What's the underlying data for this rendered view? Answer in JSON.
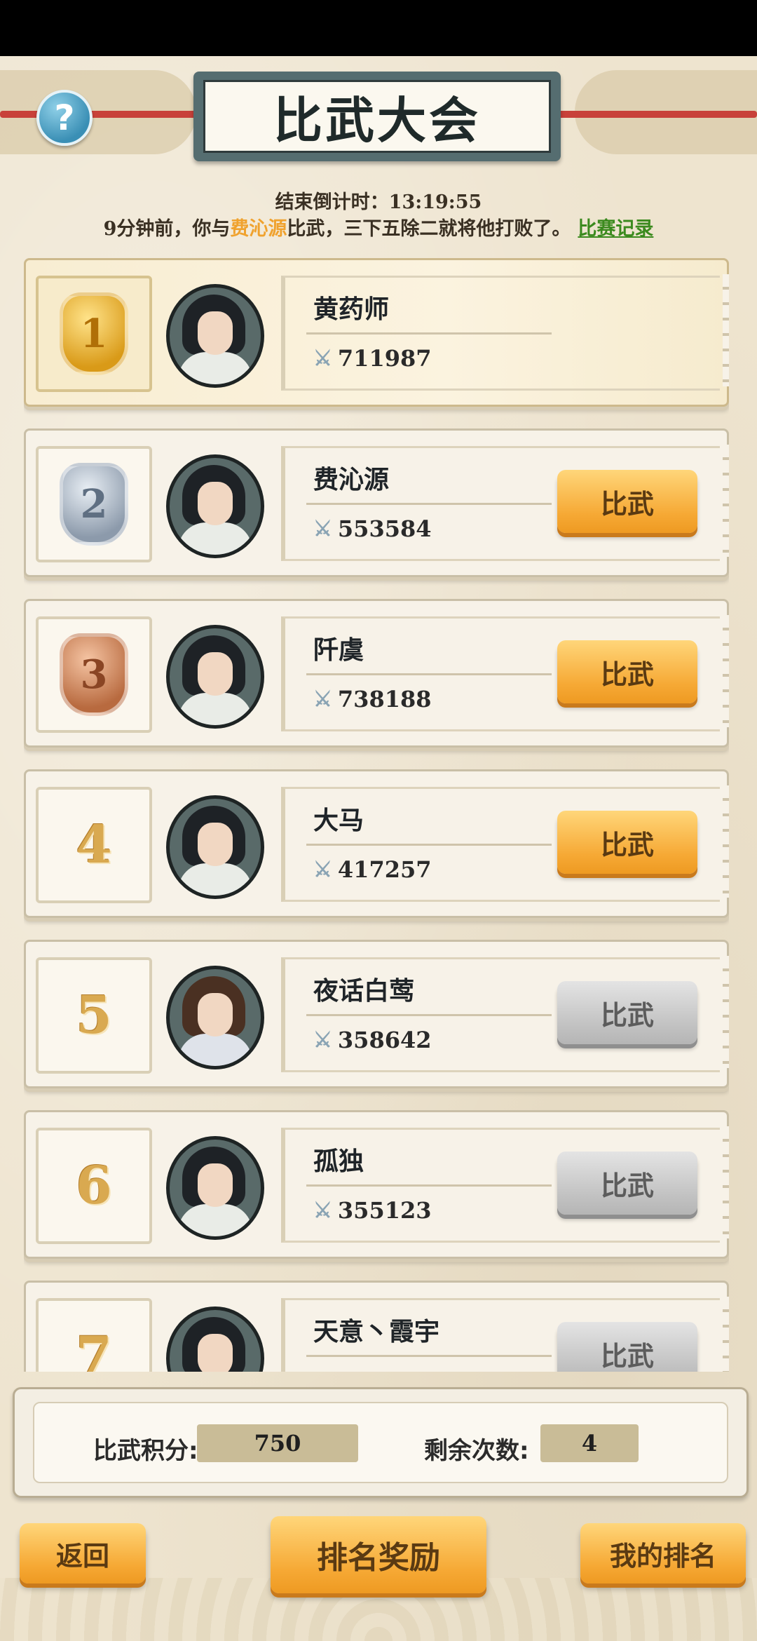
{
  "header": {
    "title": "比武大会",
    "help_icon": "question-mark-icon",
    "help_label": "?"
  },
  "status": {
    "countdown_label": "结束倒计时：",
    "countdown_value": "13:19:55",
    "notice_prefix": "9分钟前，你与",
    "notice_opponent": "费沁源",
    "notice_suffix": "比武，三下五除二就将他打败了。",
    "record_link": "比赛记录"
  },
  "ranking": [
    {
      "rank": "1",
      "medal": "gold",
      "name": "黄药师",
      "power": "711987",
      "button": "",
      "button_state": "none",
      "avatar": "black"
    },
    {
      "rank": "2",
      "medal": "silver",
      "name": "费沁源",
      "power": "553584",
      "button": "比武",
      "button_state": "active",
      "avatar": "black"
    },
    {
      "rank": "3",
      "medal": "bronze",
      "name": "阡虞",
      "power": "738188",
      "button": "比武",
      "button_state": "active",
      "avatar": "black"
    },
    {
      "rank": "4",
      "medal": "",
      "name": "大马",
      "power": "417257",
      "button": "比武",
      "button_state": "active",
      "avatar": "black"
    },
    {
      "rank": "5",
      "medal": "",
      "name": "夜话白莺",
      "power": "358642",
      "button": "比武",
      "button_state": "disabled",
      "avatar": "brown"
    },
    {
      "rank": "6",
      "medal": "",
      "name": "孤独",
      "power": "355123",
      "button": "比武",
      "button_state": "disabled",
      "avatar": "black"
    },
    {
      "rank": "7",
      "medal": "",
      "name": "天意丶霞宇",
      "power": "",
      "button": "比武",
      "button_state": "disabled",
      "avatar": "black"
    }
  ],
  "score_panel": {
    "points_label": "比武积分:",
    "points_value": "750",
    "remaining_label": "剩余次数:",
    "remaining_value": "4"
  },
  "bottom_buttons": {
    "back": "返回",
    "rank_reward": "排名奖励",
    "my_rank": "我的排名"
  },
  "colors": {
    "accent_orange": "#f6a935",
    "opponent_highlight": "#f0a22e",
    "record_link": "#3b8a1e",
    "disabled_gray": "#c2c2c2"
  }
}
